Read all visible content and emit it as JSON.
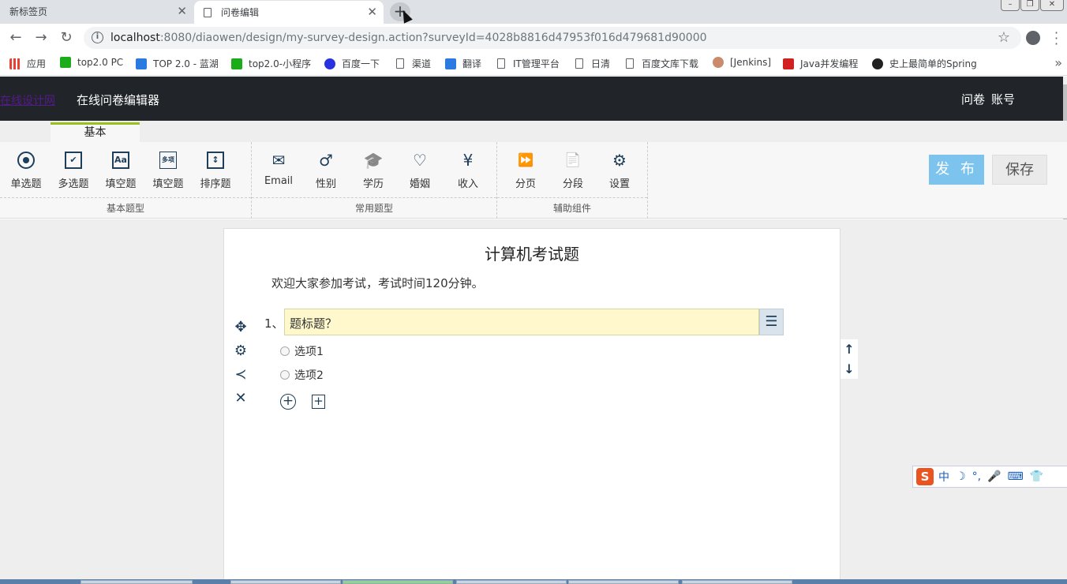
{
  "browser": {
    "tabs": [
      {
        "label": "新标签页"
      },
      {
        "label": "问卷编辑"
      }
    ],
    "new_tab": "+",
    "close": "✕",
    "url_host": "localhost",
    "url_rest": ":8080/diaowen/design/my-survey-design.action?surveyId=4028b8816d47953f016d479681d90000",
    "bookmarks": [
      {
        "label": "应用",
        "color": "#e94235"
      },
      {
        "label": "top2.0 PC",
        "color": "#1aad19"
      },
      {
        "label": "TOP 2.0 - 蓝湖",
        "color": "#2a7ae2"
      },
      {
        "label": "top2.0-小程序",
        "color": "#1aad19"
      },
      {
        "label": "百度一下",
        "color": "#2932e1"
      },
      {
        "label": "渠道",
        "color": ""
      },
      {
        "label": "翻译",
        "color": "#2a7ae2"
      },
      {
        "label": "IT管理平台",
        "color": ""
      },
      {
        "label": "日清",
        "color": ""
      },
      {
        "label": "百度文库下载",
        "color": ""
      },
      {
        "label": "[Jenkins]",
        "color": "#c98b6b"
      },
      {
        "label": "Java并发编程",
        "color": "#d02020"
      },
      {
        "label": "史上最简单的Spring",
        "color": "#222222"
      }
    ],
    "bookmarks_more": "»"
  },
  "app": {
    "brand": "在线设计网",
    "title": "在线问卷编辑器",
    "nav": [
      "问卷",
      "账号"
    ]
  },
  "ribbon": {
    "tab": "基本",
    "groups": [
      {
        "name": "基本题型",
        "tools": [
          {
            "label": "单选题",
            "icon": "radio-icon"
          },
          {
            "label": "多选题",
            "icon": "checkbox-icon"
          },
          {
            "label": "填空题",
            "icon": "text-icon",
            "glyph": "Aa"
          },
          {
            "label": "填空题",
            "icon": "multi-text-icon",
            "glyph": "多项"
          },
          {
            "label": "排序题",
            "icon": "sort-icon",
            "glyph": "↕"
          }
        ]
      },
      {
        "name": "常用题型",
        "tools": [
          {
            "label": "Email",
            "icon": "mail-icon",
            "glyph": "✉"
          },
          {
            "label": "性别",
            "icon": "gender-icon",
            "glyph": "♂"
          },
          {
            "label": "学历",
            "icon": "graduation-icon",
            "glyph": "🎓"
          },
          {
            "label": "婚姻",
            "icon": "heart-icon",
            "glyph": "♡"
          },
          {
            "label": "收入",
            "icon": "yen-icon",
            "glyph": "¥"
          }
        ]
      },
      {
        "name": "辅助组件",
        "tools": [
          {
            "label": "分页",
            "icon": "pagebreak-icon",
            "glyph": "⏩"
          },
          {
            "label": "分段",
            "icon": "paragraph-icon",
            "glyph": "📄"
          },
          {
            "label": "设置",
            "icon": "settings-doc-icon",
            "glyph": "⚙"
          }
        ]
      }
    ],
    "publish": "发 布",
    "save": "保存"
  },
  "survey": {
    "title": "计算机考试题",
    "description": "欢迎大家参加考试，考试时间120分钟。",
    "question": {
      "number": "1、",
      "title": "题标题？",
      "options": [
        "选项1",
        "选项2"
      ]
    }
  },
  "ime": {
    "logo": "S",
    "mode": "中",
    "items": [
      "☽",
      "°,",
      "🎤",
      "⌨",
      "👕"
    ]
  }
}
